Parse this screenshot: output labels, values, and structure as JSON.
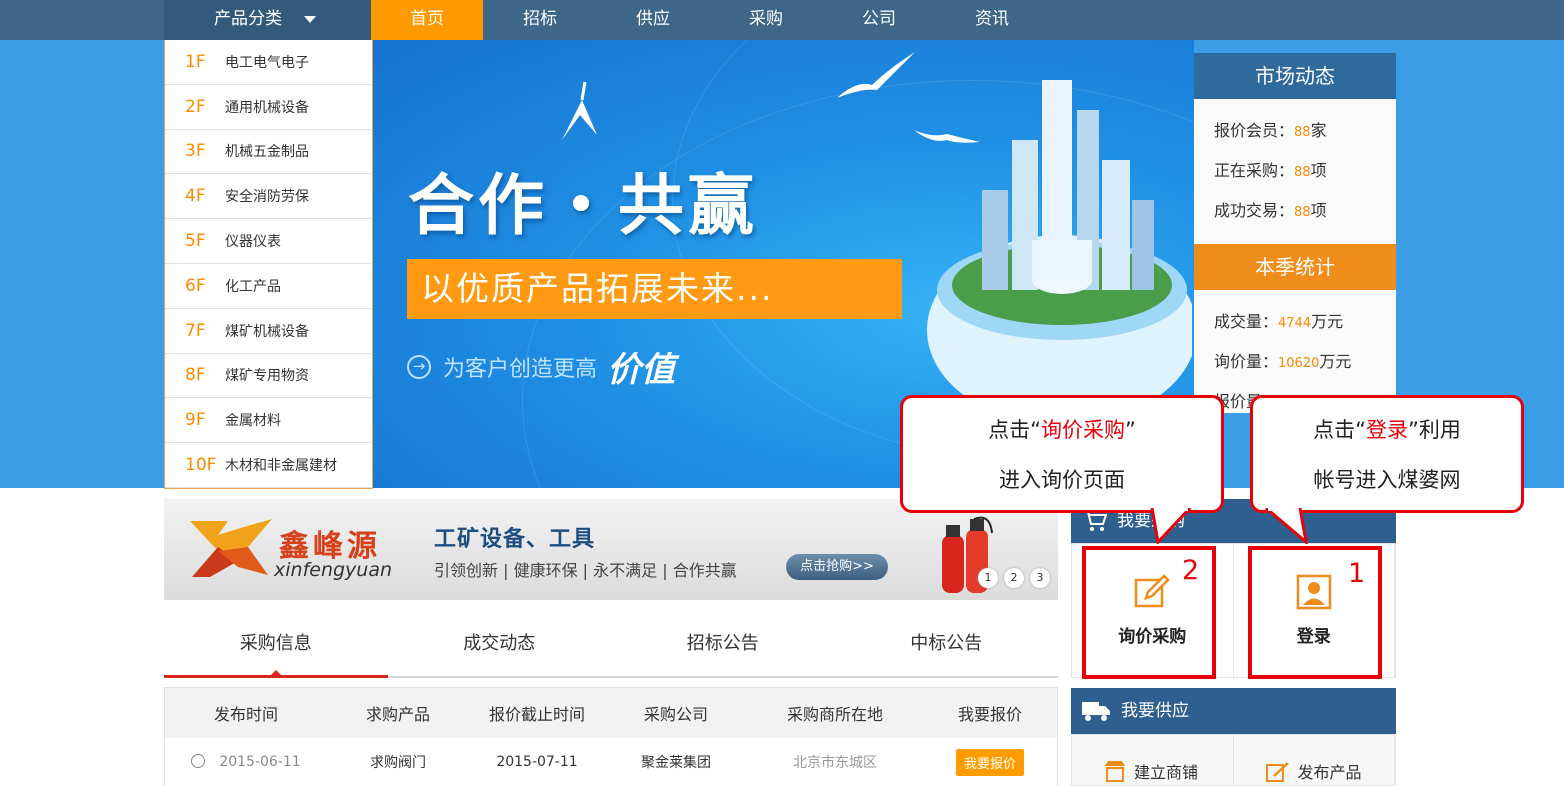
{
  "nav": {
    "category_label": "产品分类",
    "items": [
      "首页",
      "招标",
      "供应",
      "采购",
      "公司",
      "资讯"
    ]
  },
  "banner": {
    "slogan": "合作・共赢",
    "subslogan": "以优质产品拓展未来...",
    "tagline": "为客户创造更高",
    "tagline_big": "价值"
  },
  "categories": [
    {
      "floor": "1F",
      "name": "电工电气电子"
    },
    {
      "floor": "2F",
      "name": "通用机械设备"
    },
    {
      "floor": "3F",
      "name": "机械五金制品"
    },
    {
      "floor": "4F",
      "name": "安全消防劳保"
    },
    {
      "floor": "5F",
      "name": "仪器仪表"
    },
    {
      "floor": "6F",
      "name": "化工产品"
    },
    {
      "floor": "7F",
      "name": "煤矿机械设备"
    },
    {
      "floor": "8F",
      "name": "煤矿专用物资"
    },
    {
      "floor": "9F",
      "name": "金属材料"
    },
    {
      "floor": "10F",
      "name": "木材和非金属建材"
    }
  ],
  "market": {
    "title": "市场动态",
    "rows": [
      {
        "label": "报价会员：",
        "value": "88",
        "unit": "家"
      },
      {
        "label": "正在采购：",
        "value": "88",
        "unit": "项"
      },
      {
        "label": "成功交易：",
        "value": "88",
        "unit": "项"
      }
    ],
    "season_title": "本季统计",
    "season_rows": [
      {
        "label": "成交量：",
        "value": "4744",
        "unit": "万元"
      },
      {
        "label": "询价量：",
        "value": "10620",
        "unit": "万元"
      },
      {
        "label": "报价量",
        "value": "",
        "unit": ""
      }
    ]
  },
  "ad": {
    "brand_cn": "鑫峰源",
    "brand_en": "xinfengyuan",
    "headline": "工矿设备、工具",
    "sub": "引领创新 | 健康环保 | 永不满足 | 合作共赢",
    "cta": "点击抢购>>",
    "pages": [
      "1",
      "2",
      "3"
    ]
  },
  "tabs": [
    "采购信息",
    "成交动态",
    "招标公告",
    "中标公告"
  ],
  "table": {
    "headers": [
      "发布时间",
      "求购产品",
      "报价截止时间",
      "采购公司",
      "采购商所在地",
      "我要报价"
    ],
    "rows": [
      {
        "date": "2015-06-11",
        "product": "求购阀门",
        "deadline": "2015-07-11",
        "company": "聚金莱集团",
        "location": "北京市东城区",
        "action": "我要报价"
      }
    ]
  },
  "buy": {
    "title": "我要采购",
    "inquiry": "询价采购",
    "login": "登录",
    "badge_inquiry": "2",
    "badge_login": "1"
  },
  "supply": {
    "title": "我要供应",
    "shop": "建立商铺",
    "publish": "发布产品"
  },
  "callouts": {
    "left_pre": "点击“",
    "left_red": "询价采购",
    "left_post": "”",
    "left_line2": "进入询价页面",
    "right_pre": "点击“",
    "right_red": "登录",
    "right_post": "”利用",
    "right_line2": "帐号进入煤婆网"
  },
  "colors": {
    "nav_bg": "#3d6689",
    "accent": "#ff9900",
    "panel_blue": "#2f5f8e",
    "highlight_red": "#e8000b"
  }
}
